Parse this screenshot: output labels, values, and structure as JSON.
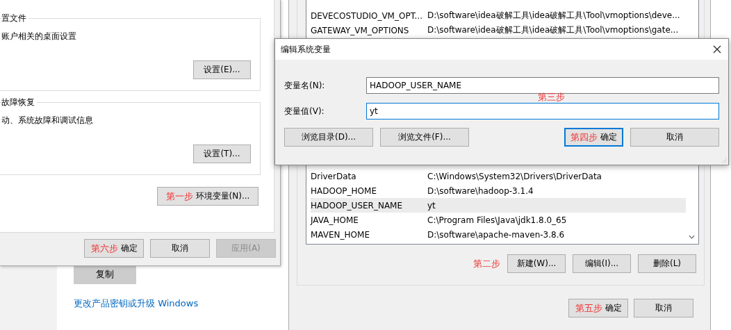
{
  "background_page": {
    "copy_button": "复制",
    "links": [
      "更改产品密钥或升级 Windows"
    ]
  },
  "system_properties": {
    "groups": [
      {
        "title": "置文件",
        "description": "账户相关的桌面设置",
        "button": "设置(E)..."
      },
      {
        "title": "故障恢复",
        "description": "动、系统故障和调试信息",
        "button": "设置(T)..."
      }
    ],
    "env_button": {
      "label": "环境变量(N)...",
      "annotation": "第一步"
    },
    "buttons": [
      {
        "label": "确定",
        "disabled": false,
        "annotation": "第六步"
      },
      {
        "label": "取消",
        "disabled": false
      },
      {
        "label": "应用(A)",
        "disabled": true
      }
    ]
  },
  "environment_variables": {
    "system_variables_top": [
      {
        "name": "DEVECOSTUDIO_VM_OPT...",
        "value": "D:\\software\\idea破解工具\\idea破解工具\\Tool\\vmoptions\\deve...",
        "selected": false
      },
      {
        "name": "GATEWAY_VM_OPTIONS",
        "value": "D:\\software\\idea破解工具\\idea破解工具\\Tool\\vmoptions\\gate...",
        "selected": false
      }
    ],
    "system_variables_bottom": [
      {
        "name": "DriverData",
        "value": "C:\\Windows\\System32\\Drivers\\DriverData",
        "selected": false
      },
      {
        "name": "HADOOP_HOME",
        "value": "D:\\software\\hadoop-3.1.4",
        "selected": false
      },
      {
        "name": "HADOOP_USER_NAME",
        "value": "yt",
        "selected": true
      },
      {
        "name": "JAVA_HOME",
        "value": "C:\\Program Files\\Java\\jdk1.8.0_65",
        "selected": false
      },
      {
        "name": "MAVEN_HOME",
        "value": "D:\\software\\apache-maven-3.8.6",
        "selected": false
      }
    ],
    "list_buttons": [
      {
        "label": "新建(W)...",
        "annotation": "第二步"
      },
      {
        "label": "编辑(I)..."
      },
      {
        "label": "删除(L)"
      }
    ],
    "buttons": [
      {
        "label": "确定",
        "annotation": "第五步"
      },
      {
        "label": "取消"
      }
    ]
  },
  "edit_dialog": {
    "title": "编辑系统变量",
    "fields": [
      {
        "label": "变量名(N):",
        "value": "HADOOP_USER_NAME",
        "focused": false
      },
      {
        "label": "变量值(V):",
        "value": "yt",
        "focused": true
      }
    ],
    "annotation": "第三步",
    "buttons": [
      {
        "label": "浏览目录(D)...",
        "default": false
      },
      {
        "label": "浏览文件(F)...",
        "default": false
      },
      {
        "label": "确定",
        "default": true,
        "annotation": "第四步"
      },
      {
        "label": "取消",
        "default": false
      }
    ]
  }
}
